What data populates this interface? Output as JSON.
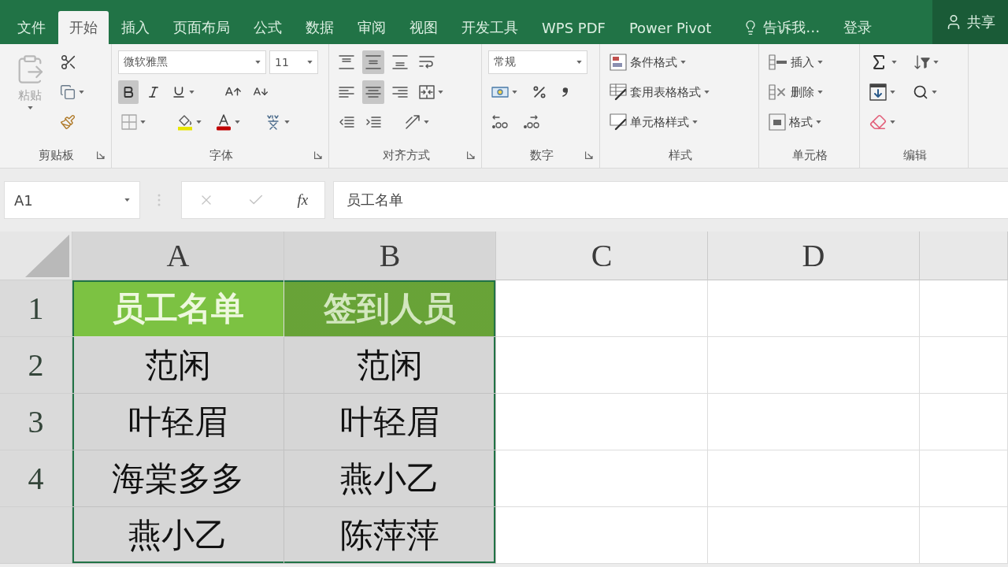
{
  "tabs": [
    {
      "label": "文件",
      "selected": false
    },
    {
      "label": "开始",
      "selected": true
    },
    {
      "label": "插入",
      "selected": false
    },
    {
      "label": "页面布局",
      "selected": false
    },
    {
      "label": "公式",
      "selected": false
    },
    {
      "label": "数据",
      "selected": false
    },
    {
      "label": "审阅",
      "selected": false
    },
    {
      "label": "视图",
      "selected": false
    },
    {
      "label": "开发工具",
      "selected": false
    },
    {
      "label": "WPS PDF",
      "selected": false
    },
    {
      "label": "Power Pivot",
      "selected": false
    }
  ],
  "tell_me": {
    "label": "告诉我…"
  },
  "sign_in": "登录",
  "share": "共享",
  "ribbon": {
    "groups": [
      {
        "kind": "clipboard",
        "label": "剪贴板",
        "launcher": true,
        "paste": {
          "label": "粘贴",
          "disabled": true
        }
      },
      {
        "kind": "font",
        "label": "字体",
        "launcher": true,
        "font_name": "微软雅黑",
        "font_size": "11",
        "bold": true,
        "italic": false,
        "underline": false
      },
      {
        "kind": "alignment",
        "label": "对齐方式",
        "launcher": true,
        "align_top": false,
        "align_middle": true,
        "align_bottom": false,
        "align_left": false,
        "align_center": true,
        "align_right": false
      },
      {
        "kind": "number",
        "label": "数字",
        "launcher": true,
        "format": "常规"
      },
      {
        "kind": "styles",
        "label": "样式",
        "launcher": false,
        "buttons": [
          "条件格式",
          "套用表格格式",
          "单元格样式"
        ]
      },
      {
        "kind": "cells",
        "label": "单元格",
        "launcher": false,
        "buttons": [
          "插入",
          "删除",
          "格式"
        ]
      },
      {
        "kind": "editing",
        "label": "编辑",
        "launcher": false
      }
    ]
  },
  "formula_bar": {
    "name_box": "A1",
    "editing": false,
    "function_button": "fx",
    "content": "员工名单"
  },
  "sheet": {
    "columns": [
      {
        "label": "A",
        "selected": true
      },
      {
        "label": "B",
        "selected": true
      },
      {
        "label": "C",
        "selected": false
      },
      {
        "label": "D",
        "selected": false
      }
    ],
    "rows": [
      {
        "label": "1",
        "selected": true,
        "kind": "header",
        "cells": [
          {
            "text": "员工名单",
            "selected": true,
            "active": true
          },
          {
            "text": "签到人员",
            "selected": true,
            "active": false
          }
        ]
      },
      {
        "label": "2",
        "selected": true,
        "kind": "data",
        "cells": [
          {
            "text": "范闲",
            "selected": true,
            "active": false
          },
          {
            "text": "范闲",
            "selected": true,
            "active": false
          }
        ]
      },
      {
        "label": "3",
        "selected": true,
        "kind": "data",
        "cells": [
          {
            "text": "叶轻眉",
            "selected": true,
            "active": false
          },
          {
            "text": "叶轻眉",
            "selected": true,
            "active": false
          }
        ]
      },
      {
        "label": "4",
        "selected": true,
        "kind": "data",
        "cells": [
          {
            "text": "海棠多多",
            "selected": true,
            "active": false
          },
          {
            "text": "燕小乙",
            "selected": true,
            "active": false
          }
        ]
      },
      {
        "selected": true,
        "kind": "data",
        "cells": [
          {
            "text": "燕小乙",
            "selected": true,
            "active": false
          },
          {
            "text": "陈萍萍",
            "selected": true,
            "active": false
          }
        ]
      }
    ]
  }
}
